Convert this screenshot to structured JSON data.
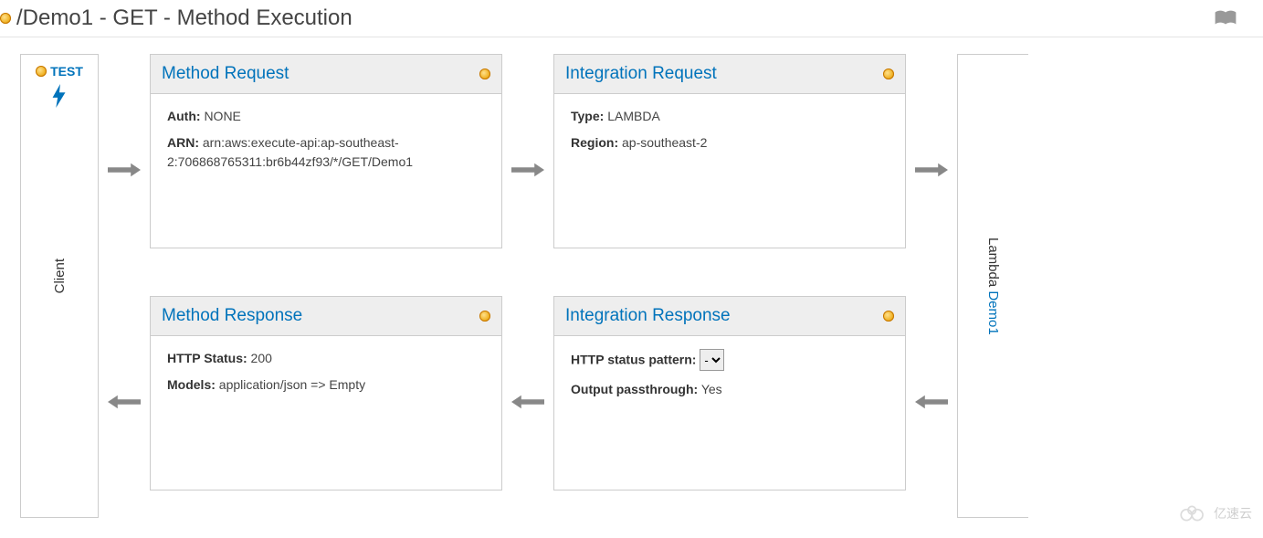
{
  "header": {
    "title": "/Demo1 - GET - Method Execution"
  },
  "client": {
    "test_label": "TEST",
    "name": "Client"
  },
  "method_request": {
    "title": "Method Request",
    "auth_label": "Auth:",
    "auth_value": "NONE",
    "arn_label": "ARN:",
    "arn_value": "arn:aws:execute-api:ap-southeast-2:706868765311:br6b44zf93/*/GET/Demo1"
  },
  "integration_request": {
    "title": "Integration Request",
    "type_label": "Type:",
    "type_value": "LAMBDA",
    "region_label": "Region:",
    "region_value": "ap-southeast-2"
  },
  "method_response": {
    "title": "Method Response",
    "status_label": "HTTP Status:",
    "status_value": "200",
    "models_label": "Models:",
    "models_value": "application/json => Empty"
  },
  "integration_response": {
    "title": "Integration Response",
    "pattern_label": "HTTP status pattern:",
    "pattern_value": "-",
    "passthrough_label": "Output passthrough:",
    "passthrough_value": "Yes"
  },
  "backend": {
    "prefix": "Lambda ",
    "name": "Demo1"
  },
  "watermark": "亿速云"
}
